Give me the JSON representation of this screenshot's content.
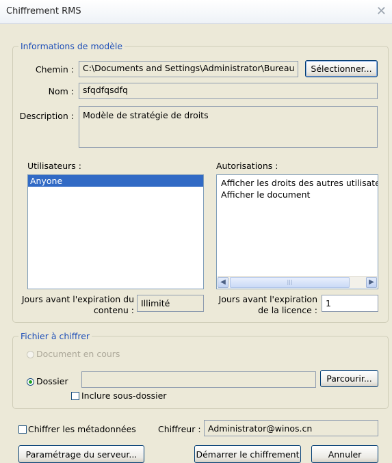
{
  "window": {
    "title": "Chiffrement RMS"
  },
  "template": {
    "legend": "Informations de modèle",
    "path_label": "Chemin :",
    "path_value": "C:\\Documents and Settings\\Administrator\\Bureau",
    "select_button": "Sélectionner...",
    "name_label": "Nom :",
    "name_value": "sfqdfqsdfq",
    "description_label": "Description :",
    "description_value": "Modèle de stratégie de droits",
    "users_label": "Utilisateurs :",
    "users": [
      "Anyone"
    ],
    "permissions_label": "Autorisations :",
    "permissions": [
      "Afficher les droits des autres utilisateurs",
      "Afficher le document"
    ],
    "content_expiry_label_1": "Jours avant l'expiration du",
    "content_expiry_label_2": "contenu :",
    "content_expiry_value": "Illimité",
    "license_expiry_label_1": "Jours avant l'expiration",
    "license_expiry_label_2": "de la licence :",
    "license_expiry_value": "1"
  },
  "file": {
    "legend": "Fichier à chiffrer",
    "current_document_label": "Document en cours",
    "folder_label": "Dossier",
    "folder_value": "",
    "browse_button": "Parcourir...",
    "include_subfolders_label": "Inclure sous-dossier"
  },
  "footer": {
    "encrypt_metadata_label": "Chiffrer les métadonnées",
    "encryptor_label": "Chiffreur :",
    "encryptor_value": "Administrator@winos.cn",
    "server_settings_button": "Paramétrage du serveur...",
    "start_button": "Démarrer le chiffrement",
    "cancel_button": "Annuler"
  },
  "colors": {
    "window_bg": "#ece9d8",
    "legend_text": "#1e4fb8",
    "selection": "#316ac5",
    "radio_dot": "#21a121"
  },
  "icons": {
    "close": "close-icon",
    "scroll_left": "arrow-left-icon",
    "scroll_right": "arrow-right-icon"
  }
}
